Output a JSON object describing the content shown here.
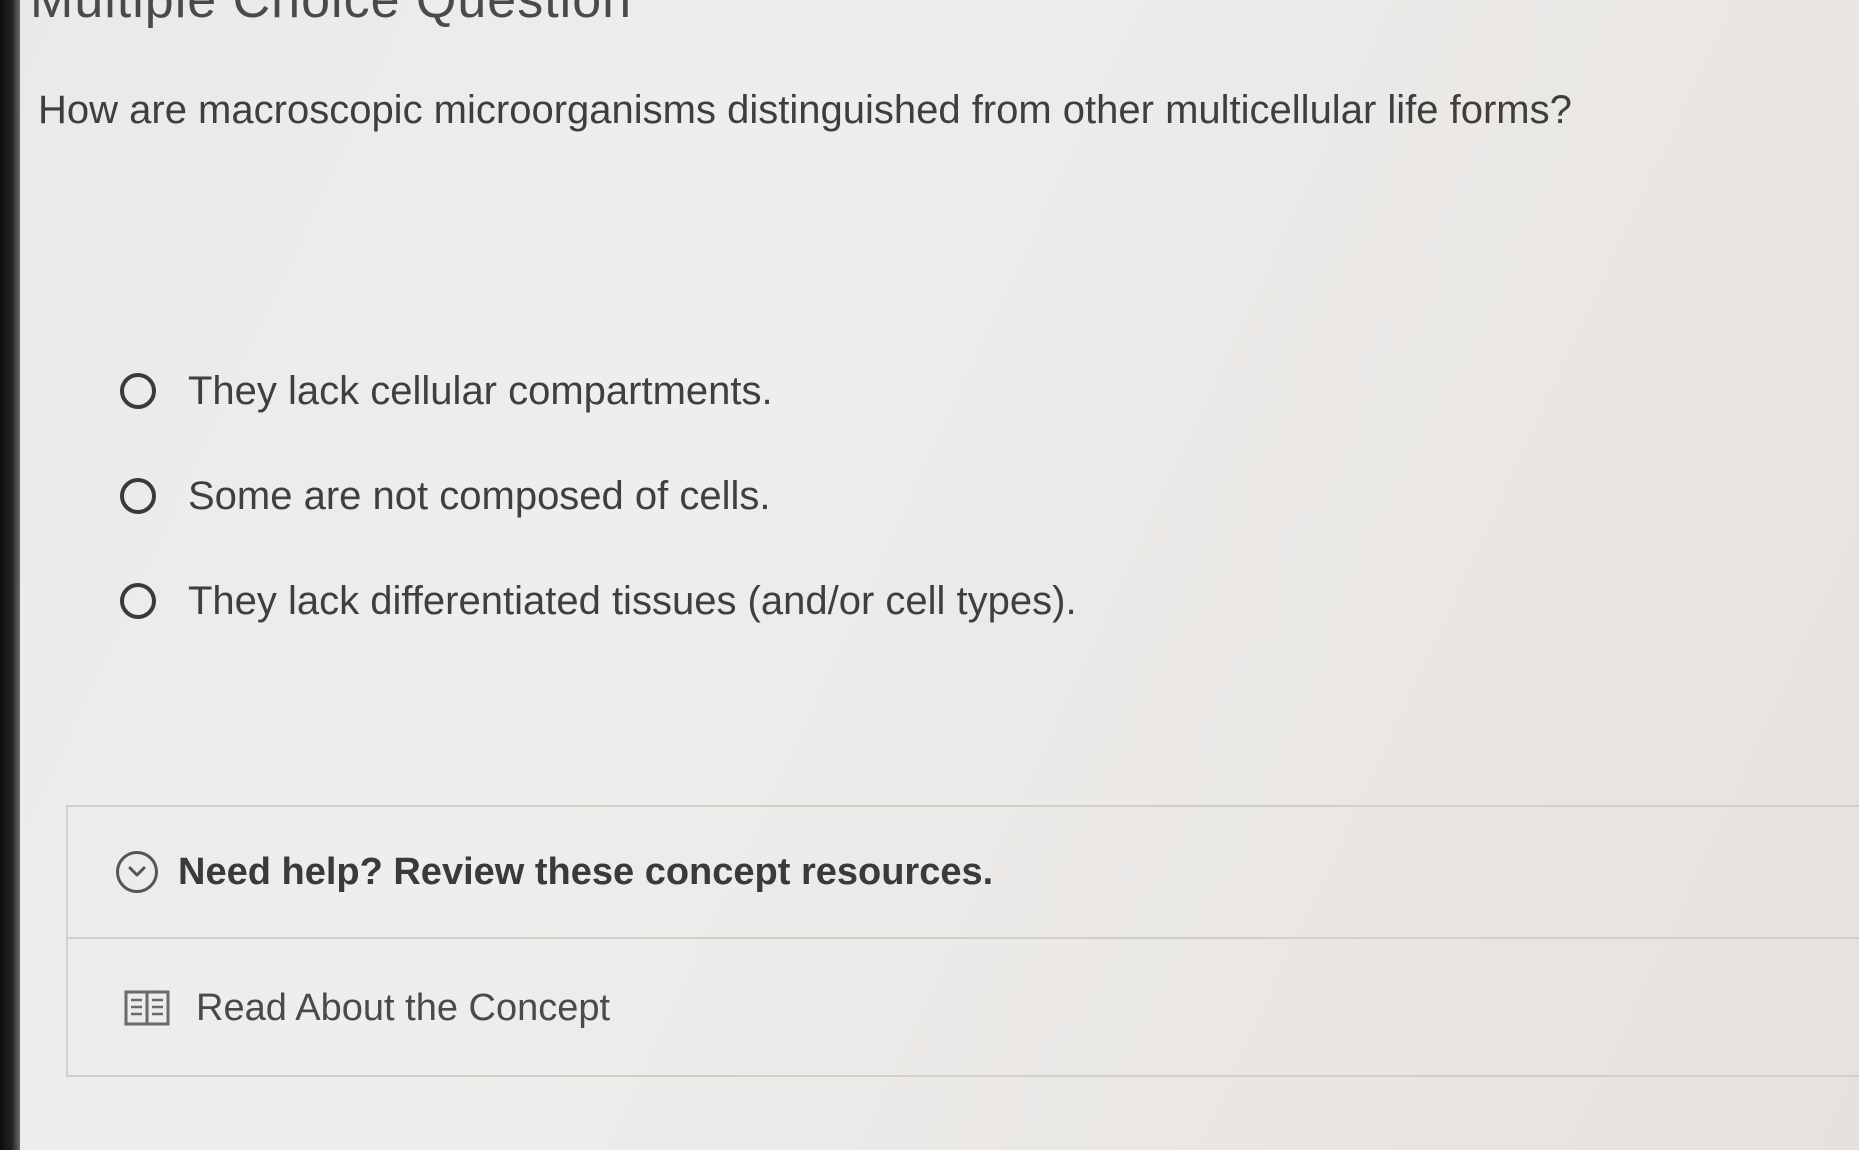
{
  "header": {
    "title": "Multiple Choice Question"
  },
  "question": {
    "text": "How are macroscopic microorganisms distinguished from other multicellular life forms?"
  },
  "options": [
    {
      "label": "They lack cellular compartments."
    },
    {
      "label": "Some are not composed of cells."
    },
    {
      "label": "They lack differentiated tissues (and/or cell types)."
    }
  ],
  "help": {
    "title": "Need help? Review these concept resources.",
    "resources": [
      {
        "label": "Read About the Concept",
        "icon": "book-icon"
      }
    ]
  }
}
